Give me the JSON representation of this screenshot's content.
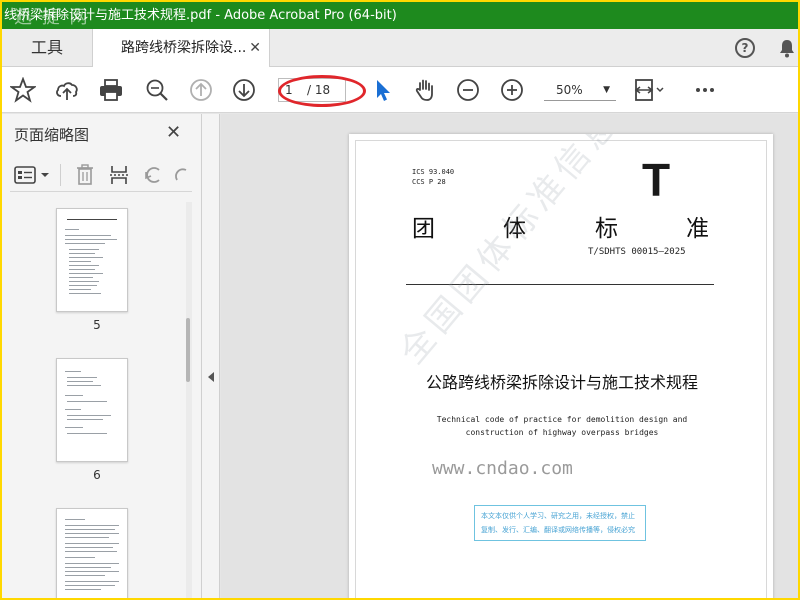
{
  "window": {
    "title": "线桥梁拆除设计与施工技术规程.pdf - Adobe Acrobat Pro (64-bit)",
    "watermark_top": "迅 捷 网",
    "accent_color": "#1e8a1e",
    "border_color": "#ffd800"
  },
  "tabs": {
    "tools_label": "工具",
    "doc_label": "路跨线桥梁拆除设...",
    "close_glyph": "✕",
    "help_glyph": "?"
  },
  "toolbar": {
    "page_current": "1",
    "page_total": "/ 18",
    "zoom": "50%",
    "icons": [
      "star-icon",
      "cloud-upload-icon",
      "print-icon",
      "zoom-search-icon",
      "page-up-icon",
      "page-down-icon",
      "select-cursor-icon",
      "hand-icon",
      "zoom-out-icon",
      "zoom-in-icon",
      "fit-page-icon",
      "more-icon"
    ],
    "highlight_color": "#e0262b"
  },
  "panel": {
    "title": "页面缩略图",
    "close_glyph": "✕",
    "thumbnails": [
      {
        "label": "5"
      },
      {
        "label": "6"
      },
      {
        "label": ""
      }
    ]
  },
  "document": {
    "ics_line1": "ICS 93.040",
    "ics_line2": "CCS P 28",
    "big_letter": "T",
    "std_chars": [
      "团",
      "体",
      "标",
      "准"
    ],
    "std_number": "T/SDHTS 00015—2025",
    "title_cn": "公路跨线桥梁拆除设计与施工技术规程",
    "title_en_line1": "Technical code of practice for demolition design and",
    "title_en_line2": "construction of highway overpass bridges",
    "notice_line1": "本文本仅供个人学习、研究之用，未经授权，禁止",
    "notice_line2": "复制、发行、汇编、翻译或网络传播等，侵权必究",
    "watermark_diag": "全国团体标准信息平台",
    "watermark_site": "www.cndao.com"
  }
}
